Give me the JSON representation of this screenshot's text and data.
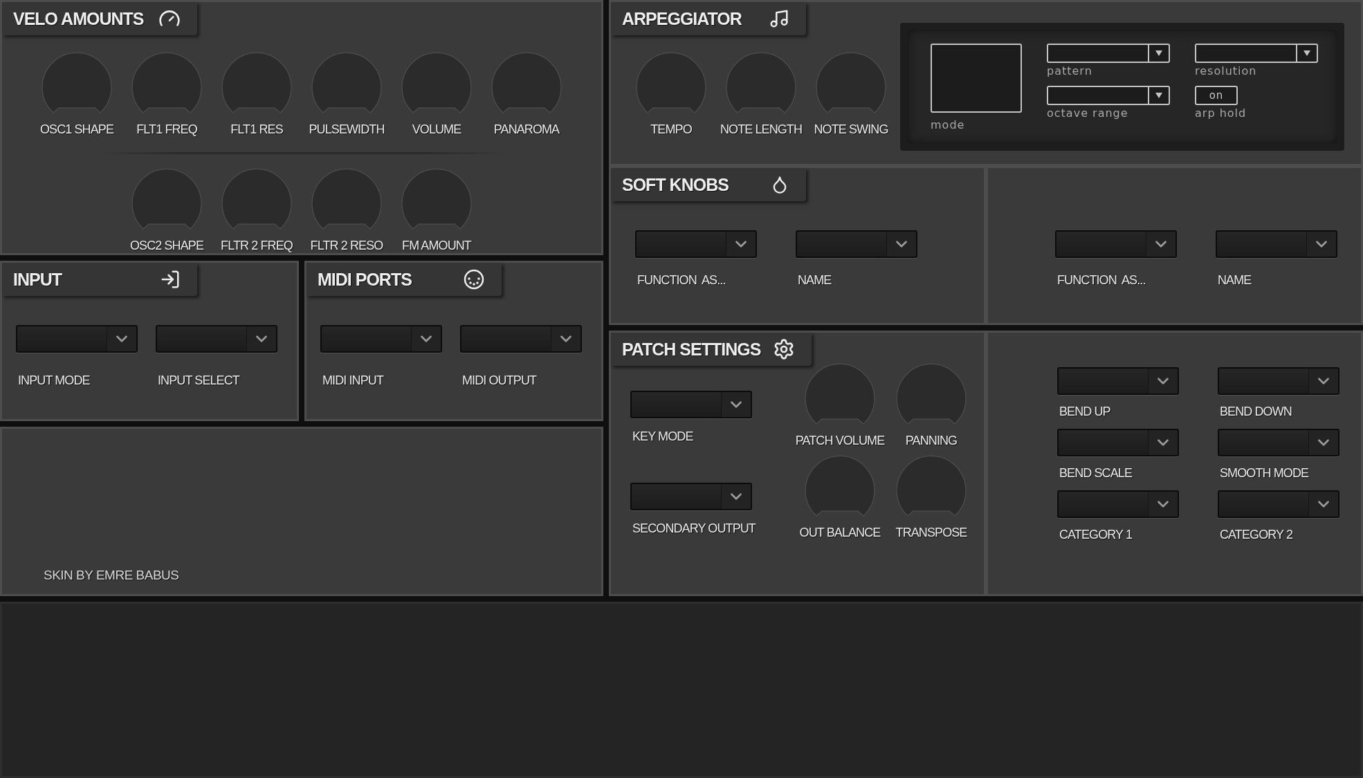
{
  "velo_amounts": {
    "title": "VELO AMOUNTS",
    "knob_rows": [
      [
        "OSC1 SHAPE",
        "FLT1 FREQ",
        "FLT1 RES",
        "PULSEWIDTH",
        "VOLUME",
        "PANAROMA"
      ],
      [
        "OSC2 SHAPE",
        "FLTR 2 FREQ",
        "FLTR 2 RESO",
        "FM AMOUNT"
      ]
    ]
  },
  "arpeggiator": {
    "title": "ARPEGGIATOR",
    "knobs": [
      "TEMPO",
      "NOTE LENGTH",
      "NOTE SWING"
    ],
    "mode_label": "mode",
    "pattern_label": "pattern",
    "resolution_label": "resolution",
    "octave_range_label": "octave range",
    "arp_hold": {
      "label": "arp hold",
      "button": "on"
    }
  },
  "soft_knobs": {
    "title": "SOFT KNOBS",
    "groups": [
      [
        "FUNCTION  AS...",
        "NAME"
      ],
      [
        "FUNCTION  AS...",
        "NAME"
      ]
    ]
  },
  "input": {
    "title": "INPUT",
    "dropdowns": [
      "INPUT MODE",
      "INPUT SELECT"
    ]
  },
  "midi_ports": {
    "title": "MIDI PORTS",
    "dropdowns": [
      "MIDI INPUT",
      "MIDI OUTPUT"
    ]
  },
  "credit": "SKIN BY EMRE BABUS",
  "patch_settings": {
    "title": "PATCH SETTINGS",
    "items": [
      {
        "kind": "dropdown",
        "label": "KEY MODE"
      },
      {
        "kind": "knob",
        "label": "PATCH VOLUME"
      },
      {
        "kind": "knob",
        "label": "PANNING"
      },
      {
        "kind": "dropdown",
        "label": "SECONDARY OUTPUT"
      },
      {
        "kind": "knob",
        "label": "OUT BALANCE"
      },
      {
        "kind": "knob",
        "label": "TRANSPOSE"
      }
    ]
  },
  "pitch_settings": {
    "dropdowns": [
      "BEND UP",
      "BEND DOWN",
      "BEND SCALE",
      "SMOOTH MODE",
      "CATEGORY 1",
      "CATEGORY 2"
    ]
  }
}
